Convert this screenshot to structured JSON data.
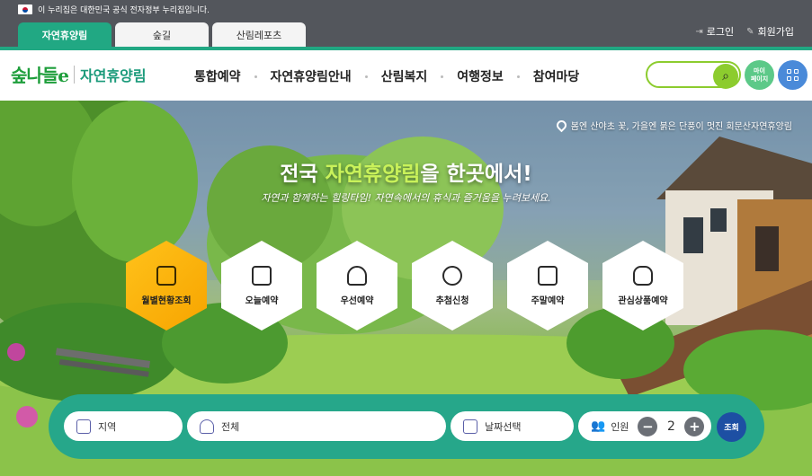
{
  "gov_notice": "이 누리집은 대한민국 공식 전자정부 누리집입니다.",
  "tabs": [
    {
      "label": "자연휴양림",
      "active": true
    },
    {
      "label": "숲길",
      "active": false
    },
    {
      "label": "산림레포츠",
      "active": false
    }
  ],
  "auth": {
    "login": "로그인",
    "signup": "회원가입"
  },
  "logo": {
    "mark": "숲나들e",
    "text": "자연휴양림"
  },
  "nav": [
    "통합예약",
    "자연휴양림안내",
    "산림복지",
    "여행정보",
    "참여마당"
  ],
  "search": {
    "placeholder": ""
  },
  "mypage_label": "마이\n페이지",
  "hero": {
    "location": "봄엔 산야초 꽃, 가을엔 붉은 단풍이 멋진 회문산자연휴양림",
    "title_prefix": "전국 ",
    "title_highlight": "자연휴양림",
    "title_suffix": "을 한곳에서!",
    "subtitle": "자연과 함께하는 힐링타임! 자연속에서의 휴식과 즐거움을 누려보세요."
  },
  "quick_menu": [
    {
      "label": "월별현황조회",
      "icon": "calendar-grid-icon",
      "active": true
    },
    {
      "label": "오늘예약",
      "icon": "calendar-check-icon",
      "active": false
    },
    {
      "label": "우선예약",
      "icon": "hand-house-icon",
      "active": false
    },
    {
      "label": "추첨신청",
      "icon": "star-person-icon",
      "active": false
    },
    {
      "label": "주말예약",
      "icon": "calendar-dots-icon",
      "active": false
    },
    {
      "label": "관심상품예약",
      "icon": "pointer-hand-icon",
      "active": false
    }
  ],
  "booking": {
    "region_label": "지역",
    "forest_label": "전체",
    "date_label": "날짜선택",
    "people_label": "인원",
    "people_count": "2",
    "minus": "−",
    "plus": "+",
    "submit": "조회"
  },
  "colors": {
    "brand_green": "#21a883",
    "accent_lime": "#8ccc2e",
    "active_yellow": "#ffc21a",
    "submit_blue": "#1d4fa3"
  }
}
